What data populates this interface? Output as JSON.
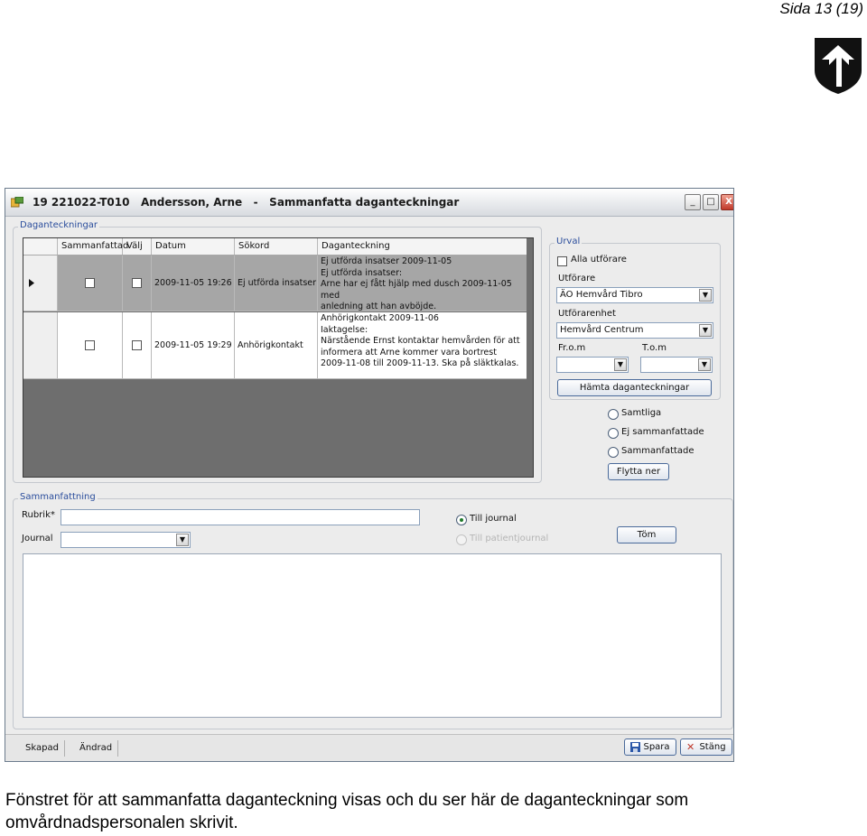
{
  "page": {
    "page_number": "Sida 13 (19)",
    "caption": "Fönstret för att sammanfatta daganteckning visas och du ser här de daganteckningar som omvårdnadspersonalen skrivit."
  },
  "window": {
    "title": "19 221022-T010   Andersson, Arne   -   Sammanfatta daganteckningar",
    "buttons": {
      "minimize": "_",
      "maximize": "□",
      "close": "X"
    }
  },
  "daganteckningar": {
    "group_label": "Daganteckningar",
    "columns": [
      "Sammanfattad",
      "Välj",
      "Datum",
      "Sökord",
      "Daganteckning"
    ],
    "rows": [
      {
        "datum": "2009-11-05 19:26",
        "sokord": "Ej utförda insatser",
        "daganteckning": [
          "Ej utförda insatser 2009-11-05",
          "Ej utförda insatser:",
          "Arne har ej fått hjälp med dusch 2009-11-05 med",
          "anledning att han avböjde."
        ]
      },
      {
        "datum": "2009-11-05 19:29",
        "sokord": "Anhörigkontakt",
        "daganteckning": [
          "Anhörigkontakt 2009-11-06",
          "Iaktagelse:",
          "Närstående Ernst kontaktar hemvården för att",
          "informera att Arne kommer vara bortrest",
          "2009-11-08 till 2009-11-13. Ska på släktkalas."
        ]
      }
    ]
  },
  "urval": {
    "group_label": "Urval",
    "alla_utforare": "Alla utförare",
    "utforare_label": "Utförare",
    "utforare_value": "ÄO Hemvård Tibro",
    "utforarenhet_label": "Utförarenhet",
    "utforarenhet_value": "Hemvård Centrum",
    "from_label": "Fr.o.m",
    "tom_label": "T.o.m",
    "hamta_button": "Hämta daganteckningar",
    "radio_samtliga": "Samtliga",
    "radio_ej_sammanfattade": "Ej sammanfattade",
    "radio_sammanfattade": "Sammanfattade",
    "flytta_button": "Flytta ner"
  },
  "sammanfattning": {
    "group_label": "Sammanfattning",
    "rubrik_label": "Rubrik*",
    "journal_label": "Journal",
    "radio_till_journal": "Till journal",
    "radio_till_patientjournal": "Till patientjournal",
    "tom_button": "Töm"
  },
  "statusbar": {
    "skapad": "Skapad",
    "andrad": "Ändrad",
    "spara_button": "Spara",
    "stang_button": "Stäng"
  }
}
